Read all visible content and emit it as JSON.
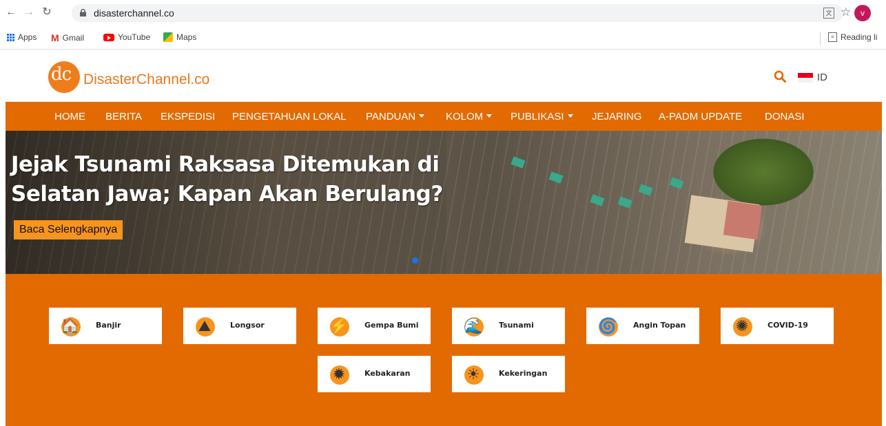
{
  "browser": {
    "url": "disasterchannel.co",
    "profile_initial": "v",
    "bookmarks": [
      {
        "label": "Apps"
      },
      {
        "label": "Gmail"
      },
      {
        "label": "YouTube"
      },
      {
        "label": "Maps"
      }
    ],
    "reading_list": "Reading li"
  },
  "site": {
    "logo_mark": "dc",
    "logo_text": "DisasterChannel.co",
    "lang": "ID",
    "brand_color": "#e26a00"
  },
  "nav": {
    "items": [
      {
        "label": "HOME"
      },
      {
        "label": "BERITA"
      },
      {
        "label": "EKSPEDISI"
      },
      {
        "label": "PENGETAHUAN LOKAL"
      },
      {
        "label": "PANDUAN"
      },
      {
        "label": "KOLOM"
      },
      {
        "label": "PUBLIKASI"
      },
      {
        "label": "JEJARING"
      },
      {
        "label": "A-PADM UPDATE"
      },
      {
        "label": "DONASI"
      }
    ]
  },
  "hero": {
    "title_line1": "Jejak Tsunami Raksasa Ditemukan di",
    "title_line2": "Selatan Jawa; Kapan Akan Berulang?",
    "cta": "Baca Selengkapnya"
  },
  "categories": [
    {
      "label": "Banjir",
      "icon": "flood-icon"
    },
    {
      "label": "Longsor",
      "icon": "landslide-icon"
    },
    {
      "label": "Gempa Bumi",
      "icon": "earthquake-icon"
    },
    {
      "label": "Tsunami",
      "icon": "tsunami-icon"
    },
    {
      "label": "Angin Topan",
      "icon": "typhoon-icon"
    },
    {
      "label": "COVID-19",
      "icon": "covid-icon"
    },
    {
      "label": "Kebakaran",
      "icon": "fire-icon"
    },
    {
      "label": "Kekeringan",
      "icon": "drought-icon"
    }
  ]
}
